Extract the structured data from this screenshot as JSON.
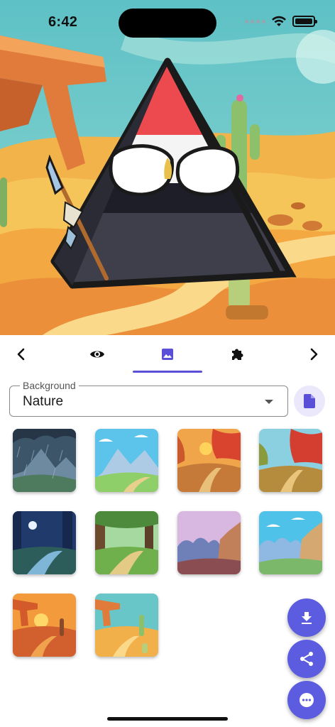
{
  "status_bar": {
    "time": "6:42"
  },
  "tabs": [
    {
      "icon": "chevron-left-icon"
    },
    {
      "icon": "eye-icon"
    },
    {
      "icon": "image-icon",
      "selected": true
    },
    {
      "icon": "puzzle-icon"
    },
    {
      "icon": "chevron-right-icon"
    }
  ],
  "background_select": {
    "label": "Background",
    "value": "Nature"
  },
  "thumbnails": [
    {
      "name": "rainy-mountain"
    },
    {
      "name": "sunny-mountain"
    },
    {
      "name": "autumn-sunset-path"
    },
    {
      "name": "autumn-day-path"
    },
    {
      "name": "night-forest-path"
    },
    {
      "name": "day-forest-path"
    },
    {
      "name": "purple-cliff-rocks"
    },
    {
      "name": "blue-cliff-rocks"
    },
    {
      "name": "desert-sunset"
    },
    {
      "name": "desert-day"
    }
  ],
  "fabs": [
    {
      "icon": "download-icon"
    },
    {
      "icon": "share-icon"
    },
    {
      "icon": "chat-icon"
    }
  ],
  "colors": {
    "accent": "#5b5ce0",
    "tab_underline": "#5b4fd8",
    "file_button_bg": "#ebe8fb"
  }
}
